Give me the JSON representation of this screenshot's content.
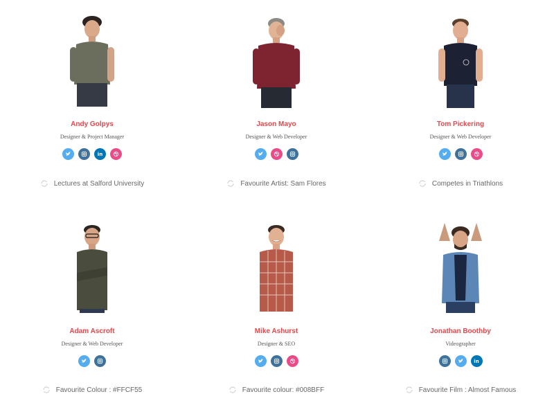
{
  "colors": {
    "name": "#e2474b",
    "twitter": "#55acee",
    "instagram": "#3f729b",
    "linkedin": "#0077b5",
    "dribbble": "#ea4c89"
  },
  "team": [
    {
      "name": "Andy Golpys",
      "role": "Designer & Project Manager",
      "socials": [
        "twitter-icon",
        "instagram-icon",
        "linkedin-icon",
        "dribbble-icon"
      ],
      "fact": "Lectures at Salford University"
    },
    {
      "name": "Jason Mayo",
      "role": "Designer & Web Developer",
      "socials": [
        "twitter-icon",
        "dribbble-icon",
        "instagram-icon"
      ],
      "fact": "Favourite Artist: Sam Flores"
    },
    {
      "name": "Tom Pickering",
      "role": "Designer & Web Developer",
      "socials": [
        "twitter-icon",
        "instagram-icon",
        "dribbble-icon"
      ],
      "fact": "Competes in Triathlons"
    },
    {
      "name": "Adam Ascroft",
      "role": "Designer & Web Developer",
      "socials": [
        "twitter-icon",
        "instagram-icon"
      ],
      "fact": "Favourite Colour : #FFCF55"
    },
    {
      "name": "Mike Ashurst",
      "role": "Designer & SEO",
      "socials": [
        "twitter-icon",
        "instagram-icon",
        "dribbble-icon"
      ],
      "fact": "Favourite colour: #008BFF"
    },
    {
      "name": "Jonathan Boothby",
      "role": "Videographer",
      "socials": [
        "instagram-icon",
        "twitter-icon",
        "linkedin-icon"
      ],
      "fact": "Favourite Film : Almost Famous"
    }
  ]
}
